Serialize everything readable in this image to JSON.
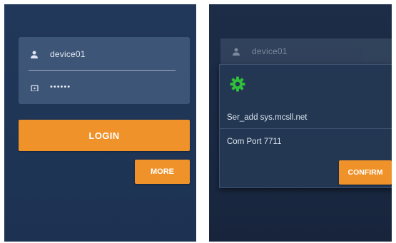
{
  "login_screen": {
    "username": "device01",
    "password_mask": "••••••",
    "login_label": "LOGIN",
    "more_label": "MORE"
  },
  "settings_screen": {
    "username": "device01",
    "server_address": "Ser_add sys.mcsll.net",
    "com_port": "Com Port 7711",
    "confirm_label": "CONFIRM"
  },
  "icons": {
    "user": "user-icon",
    "lock": "lock-icon",
    "settings": "gear-icon"
  },
  "colors": {
    "accent": "#f0922a",
    "gear": "#2fbf3a",
    "background": "#22385a"
  }
}
